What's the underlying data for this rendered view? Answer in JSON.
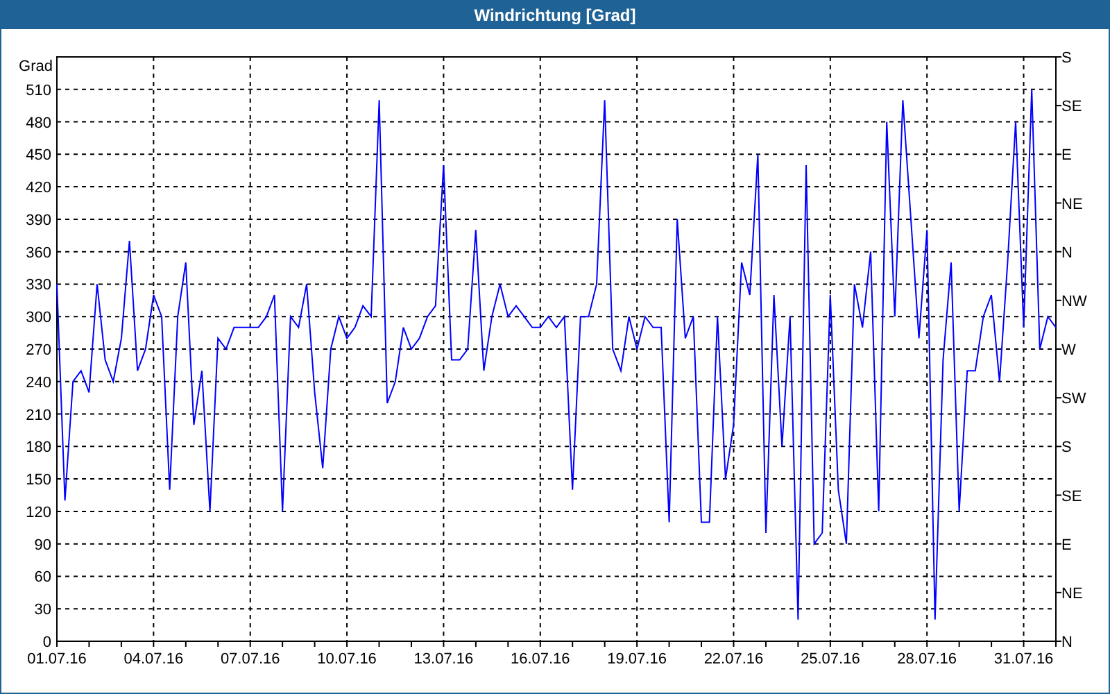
{
  "window": {
    "title": "Windrichtung [Grad]"
  },
  "chart": {
    "right_axis": [
      "S",
      "SE",
      "E",
      "NE",
      "N",
      "NW",
      "W",
      "SW",
      "S",
      "SE",
      "E",
      "NE",
      "N"
    ],
    "chart_data": {
      "type": "line",
      "ylabel": "Grad",
      "grid": true,
      "ylim": [
        0,
        540
      ],
      "categories": [
        "01.07.16",
        null,
        null,
        null,
        null,
        null,
        null,
        null,
        null,
        null,
        null,
        null,
        "04.07.16",
        null,
        null,
        null,
        null,
        null,
        null,
        null,
        null,
        null,
        null,
        null,
        "07.07.16",
        null,
        null,
        null,
        null,
        null,
        null,
        null,
        null,
        null,
        null,
        null,
        "10.07.16",
        null,
        null,
        null,
        null,
        null,
        null,
        null,
        null,
        null,
        null,
        null,
        "13.07.16",
        null,
        null,
        null,
        null,
        null,
        null,
        null,
        null,
        null,
        null,
        null,
        "16.07.16",
        null,
        null,
        null,
        null,
        null,
        null,
        null,
        null,
        null,
        null,
        null,
        "19.07.16",
        null,
        null,
        null,
        null,
        null,
        null,
        null,
        null,
        null,
        null,
        null,
        "22.07.16",
        null,
        null,
        null,
        null,
        null,
        null,
        null,
        null,
        null,
        null,
        null,
        "25.07.16",
        null,
        null,
        null,
        null,
        null,
        null,
        null,
        null,
        null,
        null,
        null,
        "28.07.16",
        null,
        null,
        null,
        null,
        null,
        null,
        null,
        null,
        null,
        null,
        null,
        "31.07.16",
        null,
        null,
        null,
        null
      ],
      "yticks": [
        0,
        30,
        60,
        90,
        120,
        150,
        180,
        210,
        240,
        270,
        300,
        330,
        360,
        390,
        420,
        450,
        480,
        510
      ],
      "series": [
        {
          "color": "#0000ff",
          "values": [
            330,
            130,
            240,
            250,
            230,
            330,
            260,
            240,
            280,
            370,
            250,
            270,
            320,
            300,
            140,
            300,
            350,
            200,
            250,
            120,
            280,
            270,
            290,
            290,
            290,
            290,
            300,
            320,
            120,
            300,
            290,
            330,
            230,
            160,
            270,
            300,
            280,
            290,
            310,
            300,
            500,
            220,
            240,
            290,
            270,
            280,
            300,
            310,
            440,
            260,
            260,
            270,
            380,
            250,
            300,
            330,
            300,
            310,
            300,
            290,
            290,
            300,
            290,
            300,
            140,
            300,
            300,
            330,
            500,
            270,
            250,
            300,
            270,
            300,
            290,
            290,
            110,
            390,
            280,
            300,
            110,
            110,
            300,
            150,
            200,
            350,
            320,
            450,
            100,
            320,
            180,
            300,
            20,
            440,
            90,
            100,
            320,
            140,
            90,
            330,
            290,
            360,
            120,
            480,
            300,
            500,
            390,
            280,
            380,
            20,
            260,
            350,
            120,
            250,
            250,
            300,
            320,
            240,
            350,
            480,
            290,
            510,
            270,
            300,
            290
          ]
        }
      ]
    }
  }
}
